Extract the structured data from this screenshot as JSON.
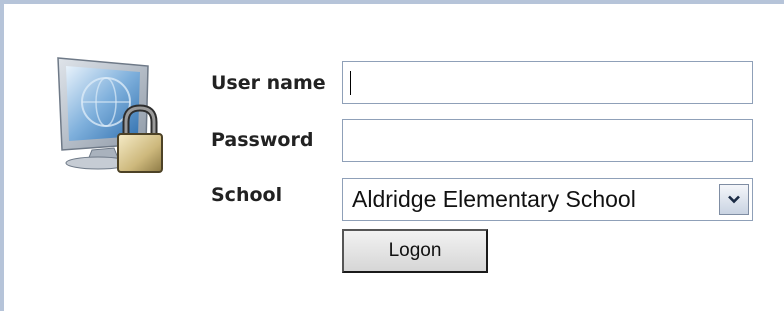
{
  "form": {
    "username_label": "User name",
    "username_value": "",
    "password_label": "Password",
    "password_value": "",
    "school_label": "School",
    "school_selected": "Aldridge Elementary School",
    "logon_label": "Logon"
  },
  "icons": {
    "computer": "computer-lock-icon",
    "dropdown": "chevron-down-icon"
  },
  "colors": {
    "frame_border": "#b6c4d9",
    "input_border": "#8fa0b8"
  }
}
